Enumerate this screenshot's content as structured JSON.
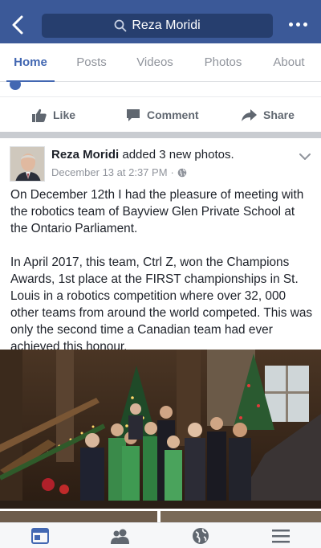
{
  "header": {
    "search_text": "Reza Moridi",
    "back_icon": "back-chevron-icon",
    "more_icon": "more-dots-icon",
    "search_icon": "search-icon",
    "bar_color": "#3b5998"
  },
  "tabs": [
    {
      "label": "Home",
      "active": true
    },
    {
      "label": "Posts",
      "active": false
    },
    {
      "label": "Videos",
      "active": false
    },
    {
      "label": "Photos",
      "active": false
    },
    {
      "label": "About",
      "active": false
    }
  ],
  "actions": {
    "like": "Like",
    "comment": "Comment",
    "share": "Share"
  },
  "post": {
    "author": "Reza Moridi",
    "action_text": " added 3 new photos.",
    "timestamp": "December 13 at 2:37 PM",
    "separator": "·",
    "privacy_icon": "globe-icon",
    "paragraph_1": "On December 12th I had the pleasure of meeting with the robotics team of Bayview Glen Private School at the Ontario Parliament.",
    "paragraph_2": "In April 2017, this team, Ctrl Z, won the Champions Awards, 1st place at the FIRST championships in St. Louis in a robotics competition where over 32, 000 other teams from around the world competed. This was only the second time a Canadian team had ever achieved this honour."
  },
  "bottom_nav": [
    {
      "icon": "news-feed-icon",
      "active": true
    },
    {
      "icon": "friends-icon",
      "active": false
    },
    {
      "icon": "globe-notifications-icon",
      "active": false
    },
    {
      "icon": "menu-icon",
      "active": false
    }
  ],
  "colors": {
    "accent": "#4267b2",
    "muted": "#90949c"
  }
}
